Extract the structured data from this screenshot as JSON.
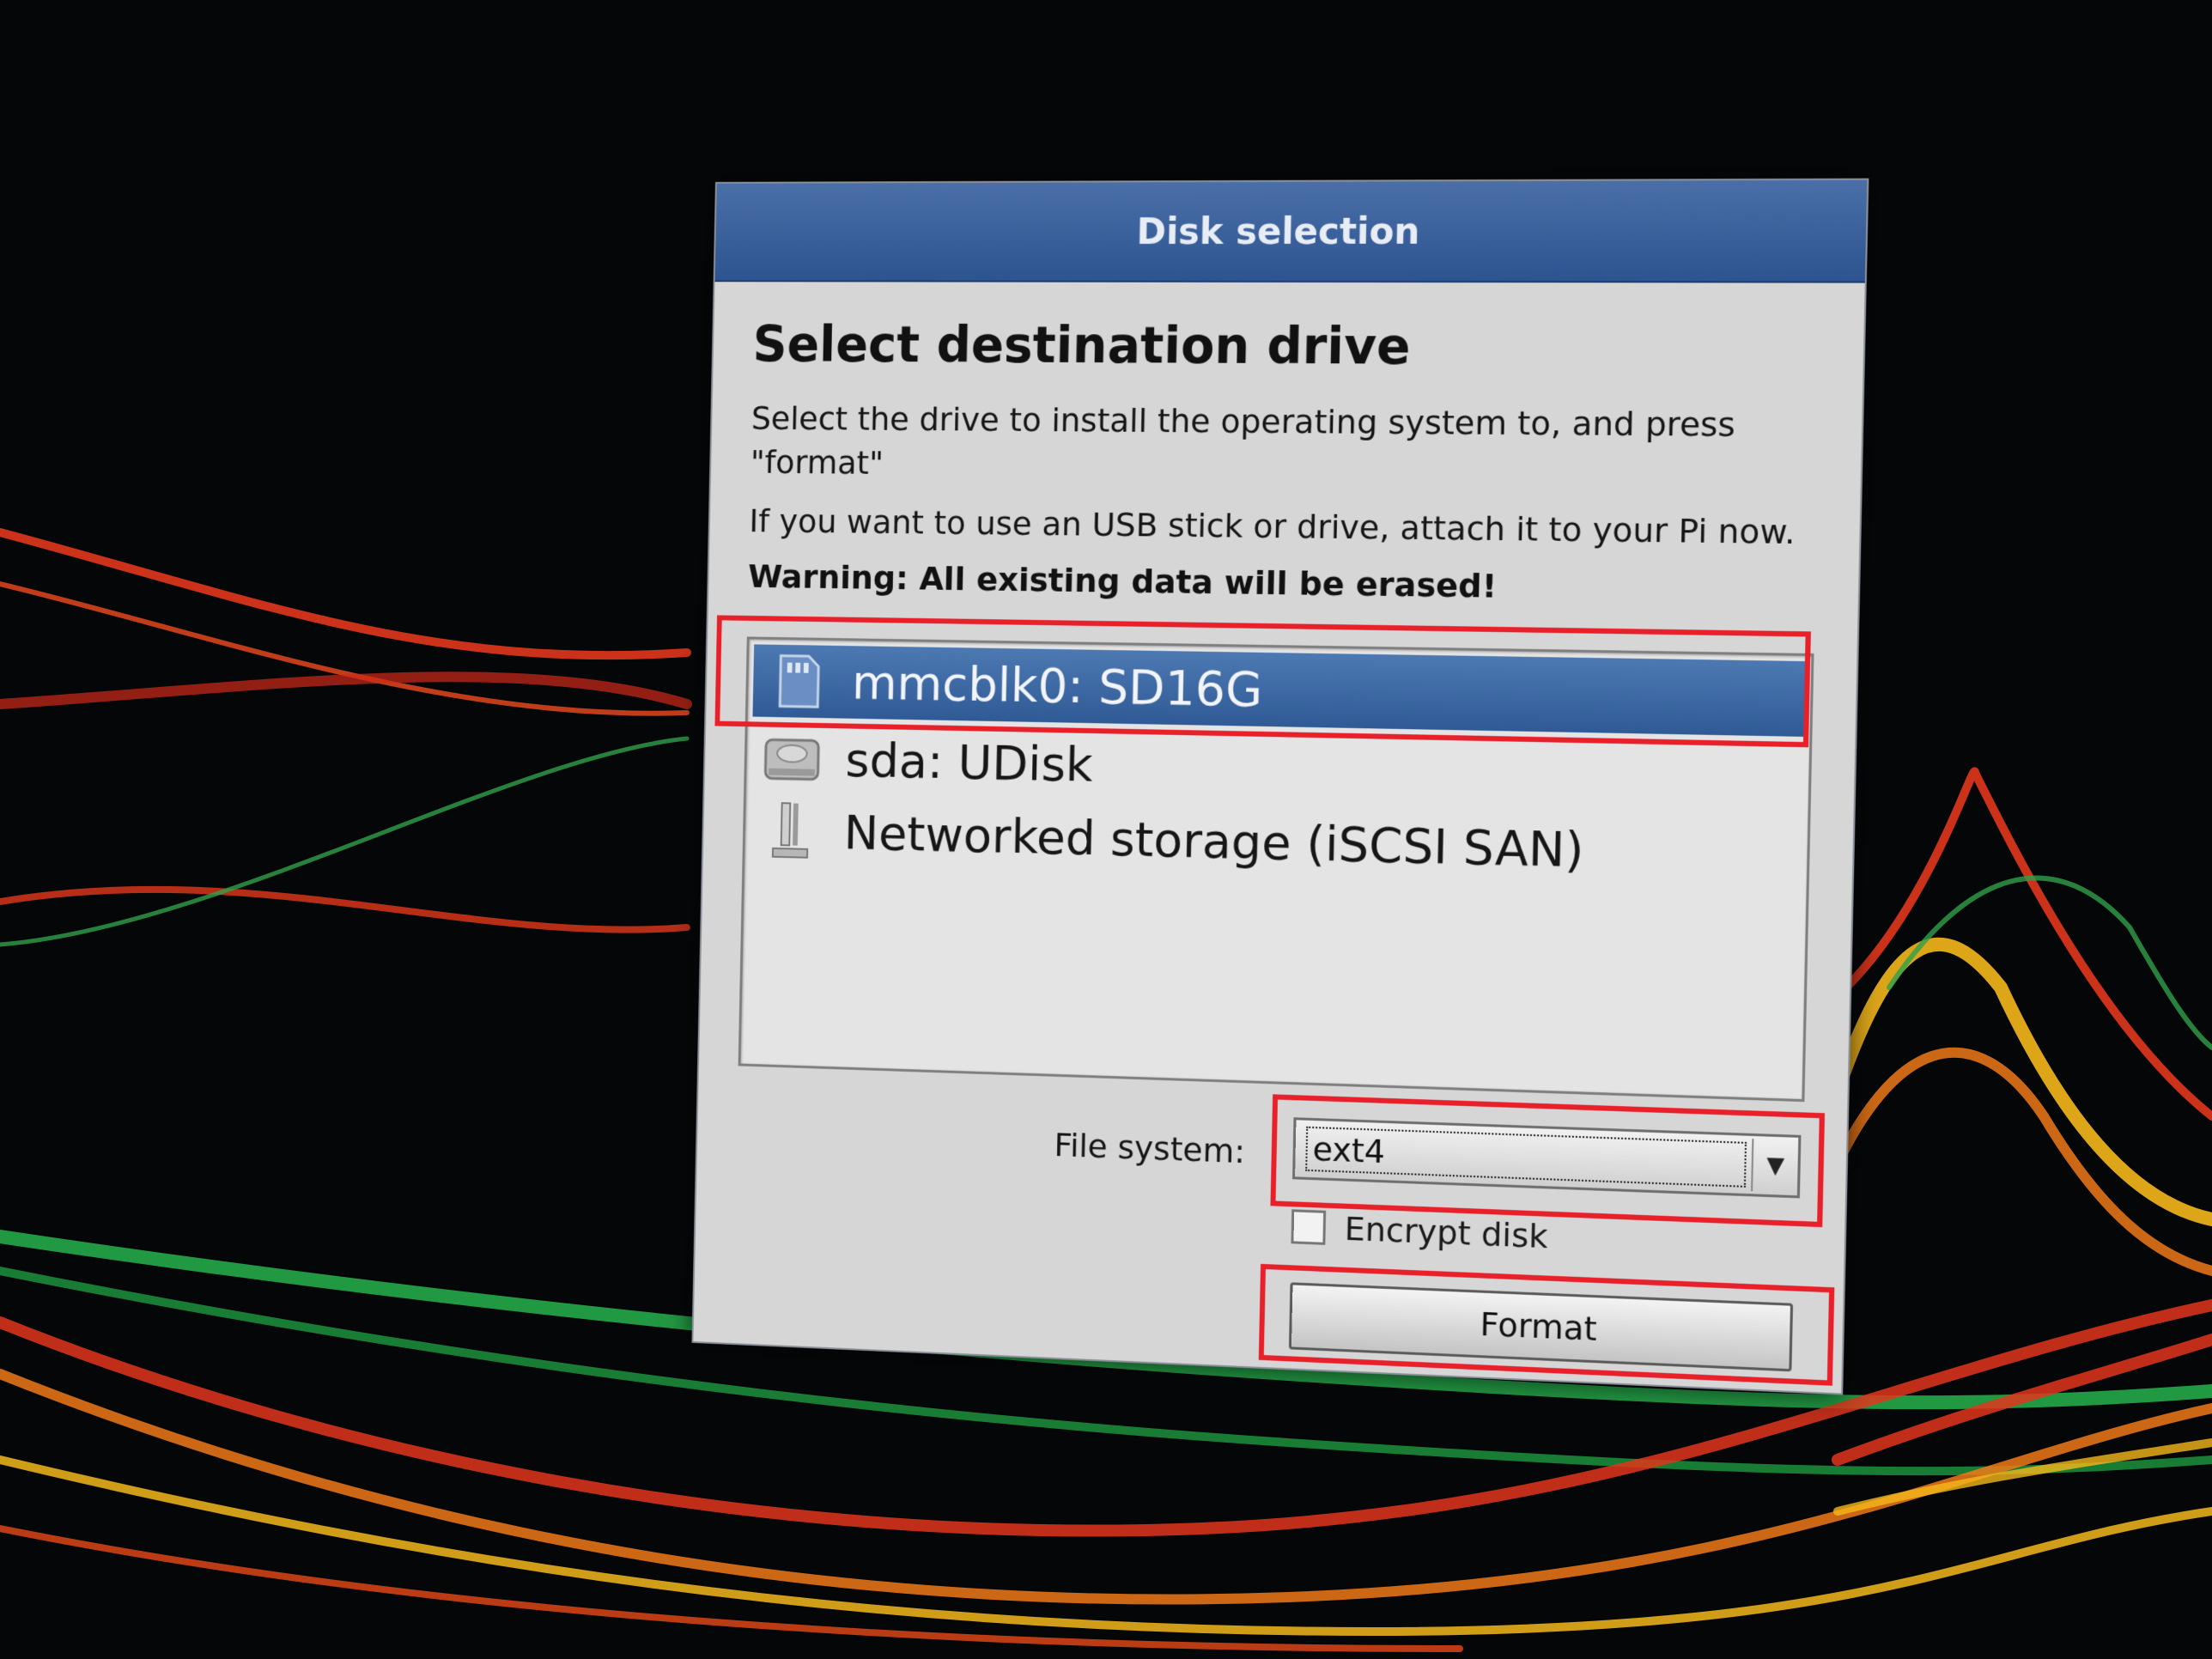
{
  "dialog": {
    "title": "Disk selection",
    "heading": "Select destination drive",
    "instructions": "Select the drive to install the operating system to, and press \"format\"",
    "usb_note": "If you want to use an USB stick or drive, attach it to your Pi now.",
    "warning": "Warning: All existing data will be erased!"
  },
  "drives": [
    {
      "label": "mmcblk0: SD16G",
      "icon": "sd-card-icon",
      "selected": true
    },
    {
      "label": "sda: UDisk",
      "icon": "hard-disk-icon",
      "selected": false
    },
    {
      "label": "Networked storage (iSCSI SAN)",
      "icon": "network-storage-icon",
      "selected": false
    }
  ],
  "file_system": {
    "label": "File system:",
    "value": "ext4"
  },
  "encrypt": {
    "label": "Encrypt disk",
    "checked": false
  },
  "format_button": {
    "label": "Format"
  },
  "colors": {
    "title_bar": "#2d5490",
    "selection": "#3a66a3",
    "highlight_box": "#e8202a",
    "dialog_bg": "#d6d6d6"
  }
}
